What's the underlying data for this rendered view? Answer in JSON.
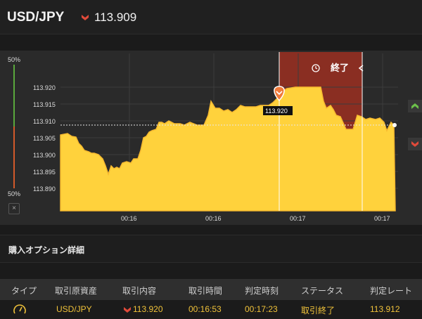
{
  "header": {
    "pair": "USD/JPY",
    "price": "113.909",
    "direction_icon": "down-arrow-icon"
  },
  "gauge": {
    "top_label": "50%",
    "bottom_label": "50%",
    "close_symbol": "×"
  },
  "chart": {
    "y_ticks": [
      "113.920",
      "113.915",
      "113.910",
      "113.905",
      "113.900",
      "113.895",
      "113.890"
    ],
    "x_ticks": [
      "00:16",
      "00:16",
      "00:17",
      "00:17"
    ],
    "entry_label": "113.920",
    "end_label": "終了",
    "line_color": "#f7c84a",
    "fill_color": "#ffd23c",
    "expired_zone_color": "#8a2e22"
  },
  "section": {
    "title": "購入オプション詳細"
  },
  "table": {
    "headers": [
      "タイプ",
      "取引原資産",
      "取引内容",
      "取引時間",
      "判定時刻",
      "ステータス",
      "判定レート"
    ],
    "row": {
      "type_icon": "timer-icon",
      "asset": "USD/JPY",
      "trade": "113.920",
      "trade_time": "00:16:53",
      "judge_time": "00:17:23",
      "status": "取引終了",
      "rate": "113.912"
    }
  }
}
